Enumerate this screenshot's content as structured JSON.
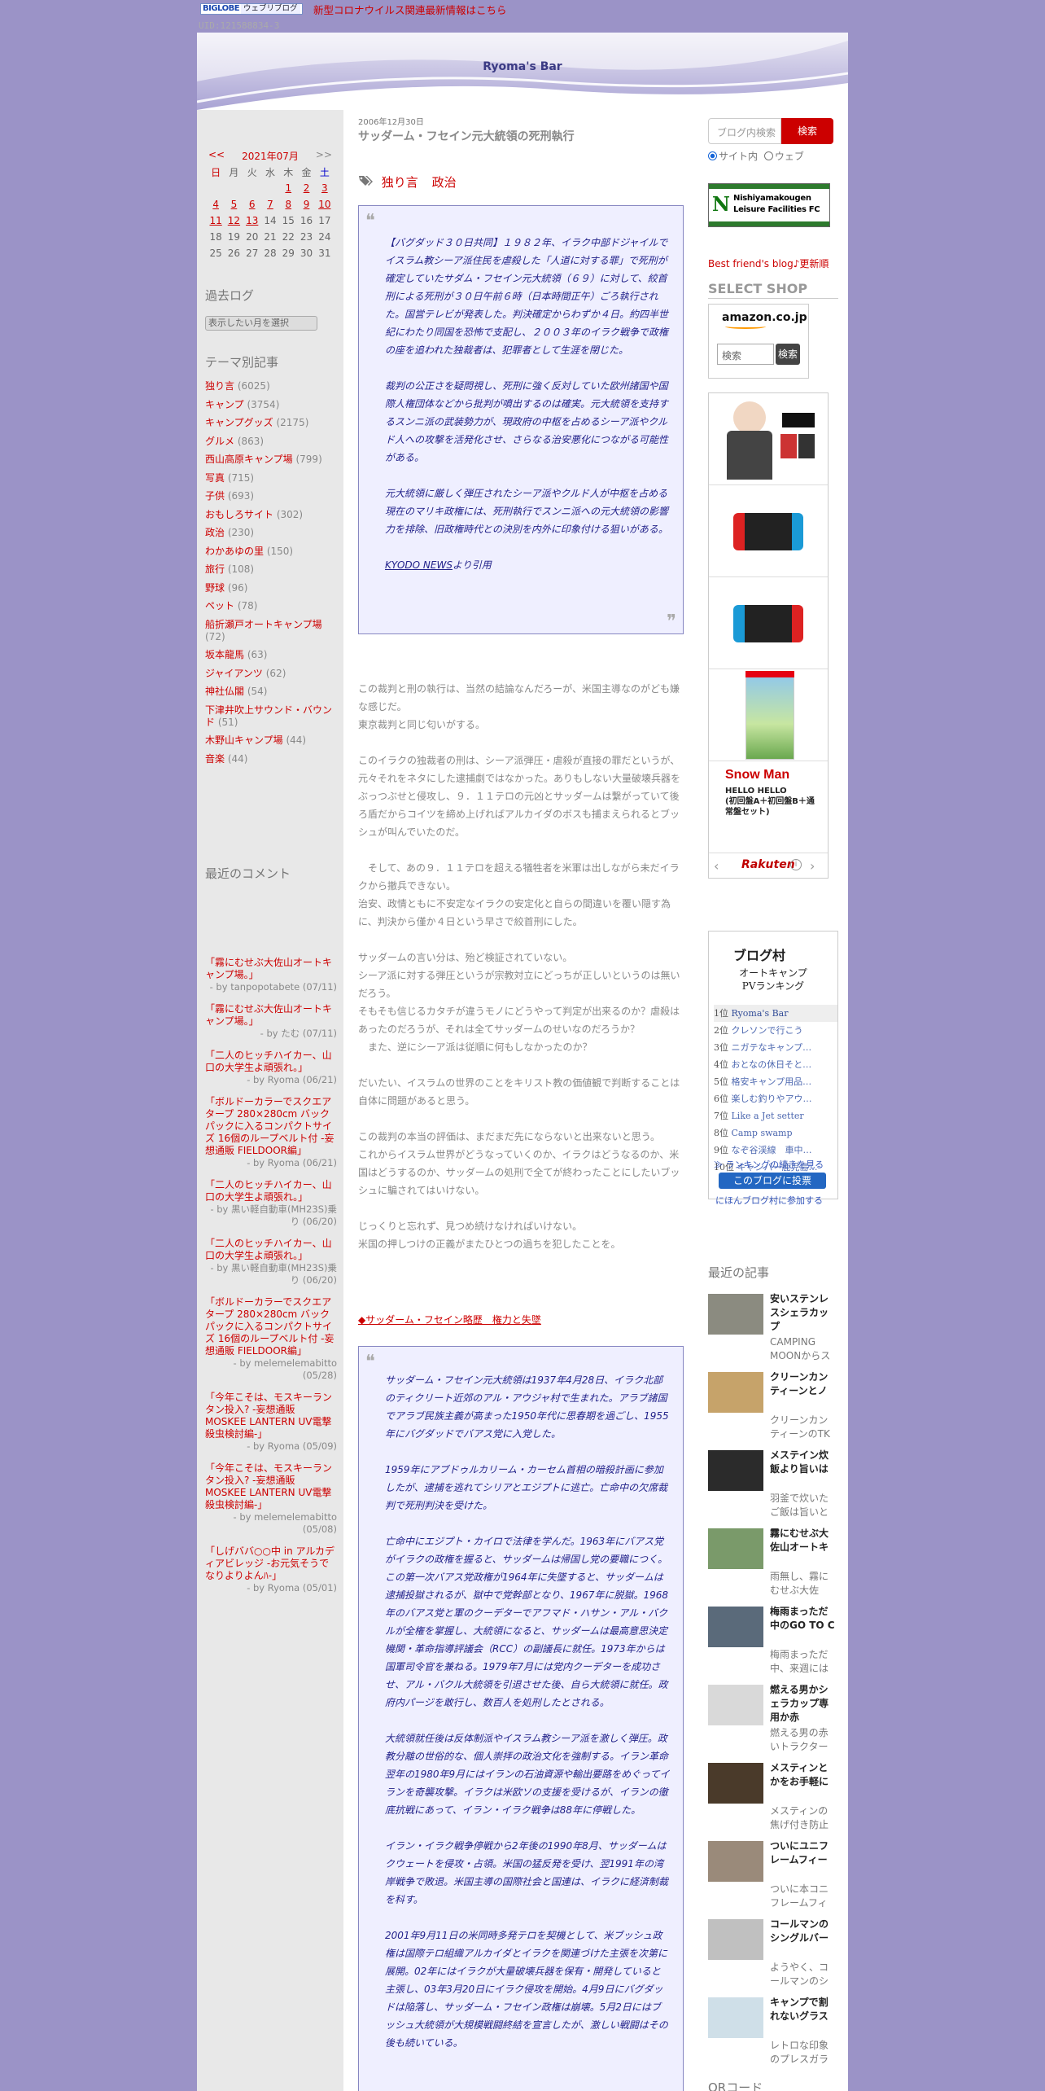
{
  "topbar": {
    "biglobe_logo": "BIGLOBE",
    "biglobe_label": "ウェブリブログ",
    "news": "新型コロナウイルス関連最新情報はこちら",
    "uid": "UID:121588834-3"
  },
  "blog": {
    "title": "Ryoma's Bar"
  },
  "calendar": {
    "prev": "<<",
    "month": "2021年07月",
    "next": ">>",
    "weekdays": [
      "日",
      "月",
      "火",
      "水",
      "木",
      "金",
      "土"
    ],
    "weeks": [
      [
        "",
        "",
        "",
        "",
        "1",
        "2",
        "3"
      ],
      [
        "4",
        "5",
        "6",
        "7",
        "8",
        "9",
        "10"
      ],
      [
        "11",
        "12",
        "13",
        "14",
        "15",
        "16",
        "17"
      ],
      [
        "18",
        "19",
        "20",
        "21",
        "22",
        "23",
        "24"
      ],
      [
        "25",
        "26",
        "27",
        "28",
        "29",
        "30",
        "31"
      ]
    ],
    "linked_days": [
      "1",
      "2",
      "3",
      "4",
      "5",
      "6",
      "7",
      "8",
      "9",
      "10",
      "11",
      "12",
      "13"
    ]
  },
  "archive": {
    "heading": "過去ログ",
    "select_placeholder": "表示したい月を選択"
  },
  "categories": {
    "heading": "テーマ別記事",
    "items": [
      {
        "name": "独り言",
        "count": "(6025)"
      },
      {
        "name": "キャンプ",
        "count": "(3754)"
      },
      {
        "name": "キャンプグッズ",
        "count": "(2175)"
      },
      {
        "name": "グルメ",
        "count": "(863)"
      },
      {
        "name": "西山高原キャンプ場",
        "count": "(799)"
      },
      {
        "name": "写真",
        "count": "(715)"
      },
      {
        "name": "子供",
        "count": "(693)"
      },
      {
        "name": "おもしろサイト",
        "count": "(302)"
      },
      {
        "name": "政治",
        "count": "(230)"
      },
      {
        "name": "わかあゆの里",
        "count": "(150)"
      },
      {
        "name": "旅行",
        "count": "(108)"
      },
      {
        "name": "野球",
        "count": "(96)"
      },
      {
        "name": "ペット",
        "count": "(78)"
      },
      {
        "name": "船折瀬戸オートキャンプ場",
        "count": "(72)"
      },
      {
        "name": "坂本龍馬",
        "count": "(63)"
      },
      {
        "name": "ジャイアンツ",
        "count": "(62)"
      },
      {
        "name": "神社仏閣",
        "count": "(54)"
      },
      {
        "name": "下津井吹上サウンド・バウンド",
        "count": "(51)"
      },
      {
        "name": "木野山キャンプ場",
        "count": "(44)"
      },
      {
        "name": "音楽",
        "count": "(44)"
      }
    ]
  },
  "recent_comments": {
    "heading": "最近のコメント",
    "items": [
      {
        "title": "「霧にむせぶ大佐山オートキャンプ場。」",
        "by": "- by tanpopotabete (07/11)"
      },
      {
        "title": "「霧にむせぶ大佐山オートキャンプ場。」",
        "by": "- by たむ (07/11)"
      },
      {
        "title": "「二人のヒッチハイカー、山口の大学生よ頑張れ。」",
        "by": "- by Ryoma (06/21)"
      },
      {
        "title": "「ボルドーカラーでスクエアタープ 280×280cm バックパックに入るコンパクトサイズ 16個のループベルト付 -妄想通販 FIELDOOR編」",
        "by": "- by Ryoma (06/21)"
      },
      {
        "title": "「二人のヒッチハイカー、山口の大学生よ頑張れ。」",
        "by": "- by 黒い軽自動車(MH23S)乗り (06/20)"
      },
      {
        "title": "「二人のヒッチハイカー、山口の大学生よ頑張れ。」",
        "by": "- by 黒い軽自動車(MH23S)乗り (06/20)"
      },
      {
        "title": "「ボルドーカラーでスクエアタープ 280×280cm バックパックに入るコンパクトサイズ 16個のループベルト付 -妄想通販 FIELDOOR編」",
        "by": "- by melemelemabitto (05/28)"
      },
      {
        "title": "「今年こそは、モスキーランタン投入? -妄想通販 MOSKEE LANTERN UV電撃殺虫検討編-」",
        "by": "- by Ryoma (05/09)"
      },
      {
        "title": "「今年こそは、モスキーランタン投入? -妄想通販 MOSKEE LANTERN UV電撃殺虫検討編-」",
        "by": "- by melemelemabitto (05/08)"
      },
      {
        "title": "「しげババ○○中 in アルカディアビレッジ -お元気そうでなりよりよんﾊ-」",
        "by": "- by Ryoma (05/01)"
      }
    ]
  },
  "post": {
    "date": "2006年12月30日",
    "title": "サッダーム・フセイン元大統領の死刑執行",
    "tags": [
      "独り言",
      "政治"
    ],
    "quote1": [
      "【バグダッド３０日共同】１９８２年、イラク中部ドジャイルでイスラム教シーア派住民を虐殺した「人道に対する罪」で死刑が確定していたサダム・フセイン元大統領（６９）に対して、絞首刑による死刑が３０日午前６時（日本時間正午）ごろ執行された。国営テレビが発表した。判決確定からわずか４日。約四半世紀にわたり同国を恐怖で支配し、２００３年のイラク戦争で政権の座を追われた独裁者は、犯罪者として生涯を閉じた。",
      "裁判の公正さを疑問視し、死刑に強く反対していた欧州諸国や国際人権団体などから批判が噴出するのは確実。元大統領を支持するスンニ派の武装勢力が、現政府の中枢を占めるシーア派やクルド人への攻撃を活発化させ、さらなる治安悪化につながる可能性がある。",
      "元大統領に厳しく弾圧されたシーア派やクルド人が中枢を占める現在のマリキ政権には、死刑執行でスンニ派への元大統領の影響力を排除、旧政権時代との決別を内外に印象付ける狙いがある。"
    ],
    "quote1_source_link": "KYODO NEWS",
    "quote1_source_suffix": "より引用",
    "body": [
      "この裁判と刑の執行は、当然の結論なんだろーが、米国主導なのがども嫌な感じだ。\n東京裁判と同じ匂いがする。",
      "このイラクの独裁者の刑は、シーア派弾圧・虐殺が直接の罪だというが、元々それをネタにした逮捕劇ではなかった。ありもしない大量破壊兵器をぶっつぶせと侵攻し、９．１１テロの元凶とサッダームは繋がっていて後ろ盾だからコイツを締め上げればアルカイダのボスも捕まえられるとブッシュが叫んでいたのだ。",
      "　そして、あの９．１１テロを超える犠牲者を米軍は出しながら未だイラクから撤兵できない。\n治安、政情ともに不安定なイラクの安定化と自らの間違いを覆い隠す為に、判決から僅か４日という早さで絞首刑にした。",
      "サッダームの言い分は、殆ど検証されていない。\nシーア派に対する弾圧というが宗教対立にどっちが正しいというのは無いだろう。\nそもそも信じるカタチが違うモノにどうやって判定が出来るのか？虐殺はあったのだろうが、それは全てサッダームのせいなのだろうか？\n　また、逆にシーア派は従順に何もしなかったのか？",
      "だいたい、イスラムの世界のことをキリスト教の価値観で判断することは自体に問題があると思う。",
      "この裁判の本当の評価は、まだまだ先にならないと出来ないと思う。\nこれからイスラム世界がどうなっていくのか、イラクはどうなるのか、米国はどうするのか、サッダームの処刑で全てが終わったことにしたいブッシュに騙されてはいけない。",
      "じっくりと忘れず、見つめ続けなければいけない。\n米国の押しつけの正義がまたひとつの過ちを犯したことを。"
    ],
    "bio_link": "◆サッダーム・フセイン略歴　権力と失墜",
    "quote2": [
      "サッダーム・フセイン元大統領は1937年4月28日、イラク北部のティクリート近郊のアル・アウジャ村で生まれた。アラブ諸国でアラブ民族主義が高まった1950年代に思春期を過ごし、1955年にバグダッドでバアス党に入党した。",
      "1959年にアブドゥルカリーム・カーセム首相の暗殺計画に参加したが、逮捕を逃れてシリアとエジプトに逃亡。亡命中の欠席裁判で死刑判決を受けた。",
      "亡命中にエジプト・カイロで法律を学んだ。1963年にバアス党がイラクの政権を握ると、サッダームは帰国し党の要職につく。この第一次バアス党政権が1964年に失墜すると、サッダームは逮捕投獄されるが、獄中で党幹部となり、1967年に脱獄。1968年のバアス党と軍のクーデターでアフマド・ハサン・アル・バクルが全権を掌握し、大統領になると、サッダームは最高意思決定機関・革命指導評議会（RCC）の副議長に就任。1973年からは国軍司令官を兼ねる。1979年7月には党内クーデターを成功させ、アル・バクル大統領を引退させた後、自ら大統領に就任。政府内パージを敢行し、数百人を処刑したとされる。",
      "大統領就任後は反体制派やイスラム教シーア派を激しく弾圧。政教分離の世俗的な、個人崇拝の政治文化を強制する。イラン革命翌年の1980年9月にはイランの石油資源や輸出要路をめぐってイランを奇襲攻撃。イラクは米欧ソの支援を受けるが、イランの徹底抗戦にあって、イラン・イラク戦争は88年に停戦した。",
      "イラン・イラク戦争停戦から2年後の1990年8月、サッダームはクウェートを侵攻・占領。米国の猛反発を受け、翌1991年の湾岸戦争で敗退。米国主導の国際社会と国連は、イラクに経済制裁を科す。",
      "2001年9月11日の米同時多発テロを契機として、米ブッシュ政権は国際テロ組織アルカイダとイラクを関連づけた主張を次第に展開。02年にはイラクが大量破壊兵器を保有・開発していると主張し、03年3月20日にイラク侵攻を開始。4月9日にバグダッドは陥落し、サッダーム・フセイン政権は崩壊。5月2日にはブッシュ大統領が大規模戦闘終結を宣言したが、激しい戦闘はその後も続いている。"
    ]
  },
  "search": {
    "placeholder": "ブログ内検索",
    "button": "検索",
    "option_site": "サイト内",
    "option_web": "ウェブ"
  },
  "banner": {
    "line1": "Nishiyamakougen",
    "line2": "Leisure Facilities FC",
    "letter": "N"
  },
  "best_friend": "Best friend's blog♪更新順",
  "shop": {
    "heading": "SELECT SHOP",
    "amazon_logo": "amazon.co.jp",
    "amazon_placeholder": "検索",
    "amazon_button": "検索",
    "rakuten_logo": "Rakuten",
    "products": [
      "snow-man-album"
    ],
    "snowman_title": "Snow Man",
    "snowman_sub": "HELLO HELLO\n(初回盤A＋初回盤B＋通常盤セット)"
  },
  "blogmura": {
    "logo": "ブログ村",
    "category": "オートキャンプ",
    "ranking_label": "PVランキング",
    "ranks": [
      {
        "n": "1位",
        "name": "Ryoma's Bar"
      },
      {
        "n": "2位",
        "name": "クレソンで行こう"
      },
      {
        "n": "3位",
        "name": "ニガテなキャンプ…"
      },
      {
        "n": "4位",
        "name": "おとなの休日そと…"
      },
      {
        "n": "5位",
        "name": "格安キャンプ用品…"
      },
      {
        "n": "6位",
        "name": "楽しむ釣りやアウ…"
      },
      {
        "n": "7位",
        "name": "Like a Jet setter"
      },
      {
        "n": "8位",
        "name": "Camp swamp"
      },
      {
        "n": "9位",
        "name": "なぞ谷渓線　車中…"
      },
      {
        "n": "10位",
        "name": "キャンパー鹿児島…"
      }
    ],
    "more": "≫ ランキングの続きを見る",
    "vote": "このブログに投票",
    "join": "にほんブログ村に参加する"
  },
  "recent_posts": {
    "heading": "最近の記事",
    "items": [
      {
        "title": "安いステンレスシェラカップ",
        "excerpt": "CAMPING MOONからステ"
      },
      {
        "title": "クリーンカンティーンとノ",
        "excerpt": "クリーンカンティーンのTK"
      },
      {
        "title": "メステイン炊飯より旨いは",
        "excerpt": "羽釜で炊いたご飯は旨いと"
      },
      {
        "title": "霧にむせぶ大佐山オートキ",
        "excerpt": "雨無し、霧にむせぶ大佐"
      },
      {
        "title": "梅雨まっただ中のGO TO C",
        "excerpt": "梅雨まっただ中、来週には"
      },
      {
        "title": "燃える男かシェラカップ専用か赤",
        "excerpt": "燃える男の赤いトラクター"
      },
      {
        "title": "メスティンとかをお手軽に",
        "excerpt": "メスティンの焦げ付き防止"
      },
      {
        "title": "ついにユニフレームフィー",
        "excerpt": "ついに本コニフレームフィ"
      },
      {
        "title": "コールマンのシングルバー",
        "excerpt": "ようやく、コールマンのシ"
      },
      {
        "title": "キャンプで割れないグラス",
        "excerpt": "レトロな印象のプレスガラ"
      }
    ]
  },
  "qr": {
    "heading": "QRコード"
  },
  "colors": {
    "background": "#9b93c7",
    "accent": "#cc0000",
    "quote_text": "#22228a"
  }
}
